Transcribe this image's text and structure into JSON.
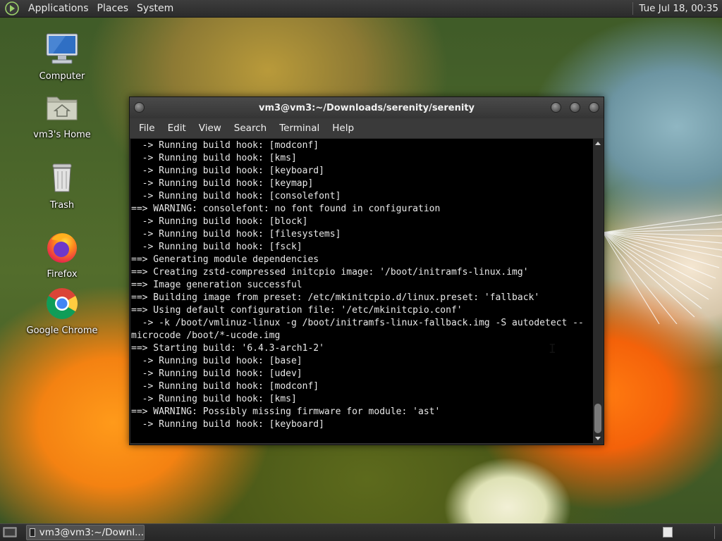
{
  "top_panel": {
    "menus": [
      "Applications",
      "Places",
      "System"
    ],
    "clock": "Tue Jul 18, 00:35"
  },
  "desktop_icons": [
    {
      "label": "Computer",
      "icon": "computer-icon"
    },
    {
      "label": "vm3's Home",
      "icon": "home-folder-icon"
    },
    {
      "label": "Trash",
      "icon": "trash-icon"
    },
    {
      "label": "Firefox",
      "icon": "firefox-icon"
    },
    {
      "label": "Google Chrome",
      "icon": "chrome-icon"
    }
  ],
  "terminal": {
    "title": "vm3@vm3:~/Downloads/serenity/serenity",
    "menu": [
      "File",
      "Edit",
      "View",
      "Search",
      "Terminal",
      "Help"
    ],
    "lines": [
      "  -> Running build hook: [modconf]",
      "  -> Running build hook: [kms]",
      "  -> Running build hook: [keyboard]",
      "  -> Running build hook: [keymap]",
      "  -> Running build hook: [consolefont]",
      "==> WARNING: consolefont: no font found in configuration",
      "  -> Running build hook: [block]",
      "  -> Running build hook: [filesystems]",
      "  -> Running build hook: [fsck]",
      "==> Generating module dependencies",
      "==> Creating zstd-compressed initcpio image: '/boot/initramfs-linux.img'",
      "==> Image generation successful",
      "==> Building image from preset: /etc/mkinitcpio.d/linux.preset: 'fallback'",
      "==> Using default configuration file: '/etc/mkinitcpio.conf'",
      "  -> -k /boot/vmlinuz-linux -g /boot/initramfs-linux-fallback.img -S autodetect --",
      "microcode /boot/*-ucode.img",
      "==> Starting build: '6.4.3-arch1-2'",
      "  -> Running build hook: [base]",
      "  -> Running build hook: [udev]",
      "  -> Running build hook: [modconf]",
      "  -> Running build hook: [kms]",
      "==> WARNING: Possibly missing firmware for module: 'ast'",
      "  -> Running build hook: [keyboard]"
    ]
  },
  "taskbar": {
    "task_label": "vm3@vm3:~/Downl..."
  },
  "colors": {
    "panel_bg": "#2b2b2b",
    "terminal_bg": "#000000",
    "terminal_fg": "#e8e8e8"
  }
}
